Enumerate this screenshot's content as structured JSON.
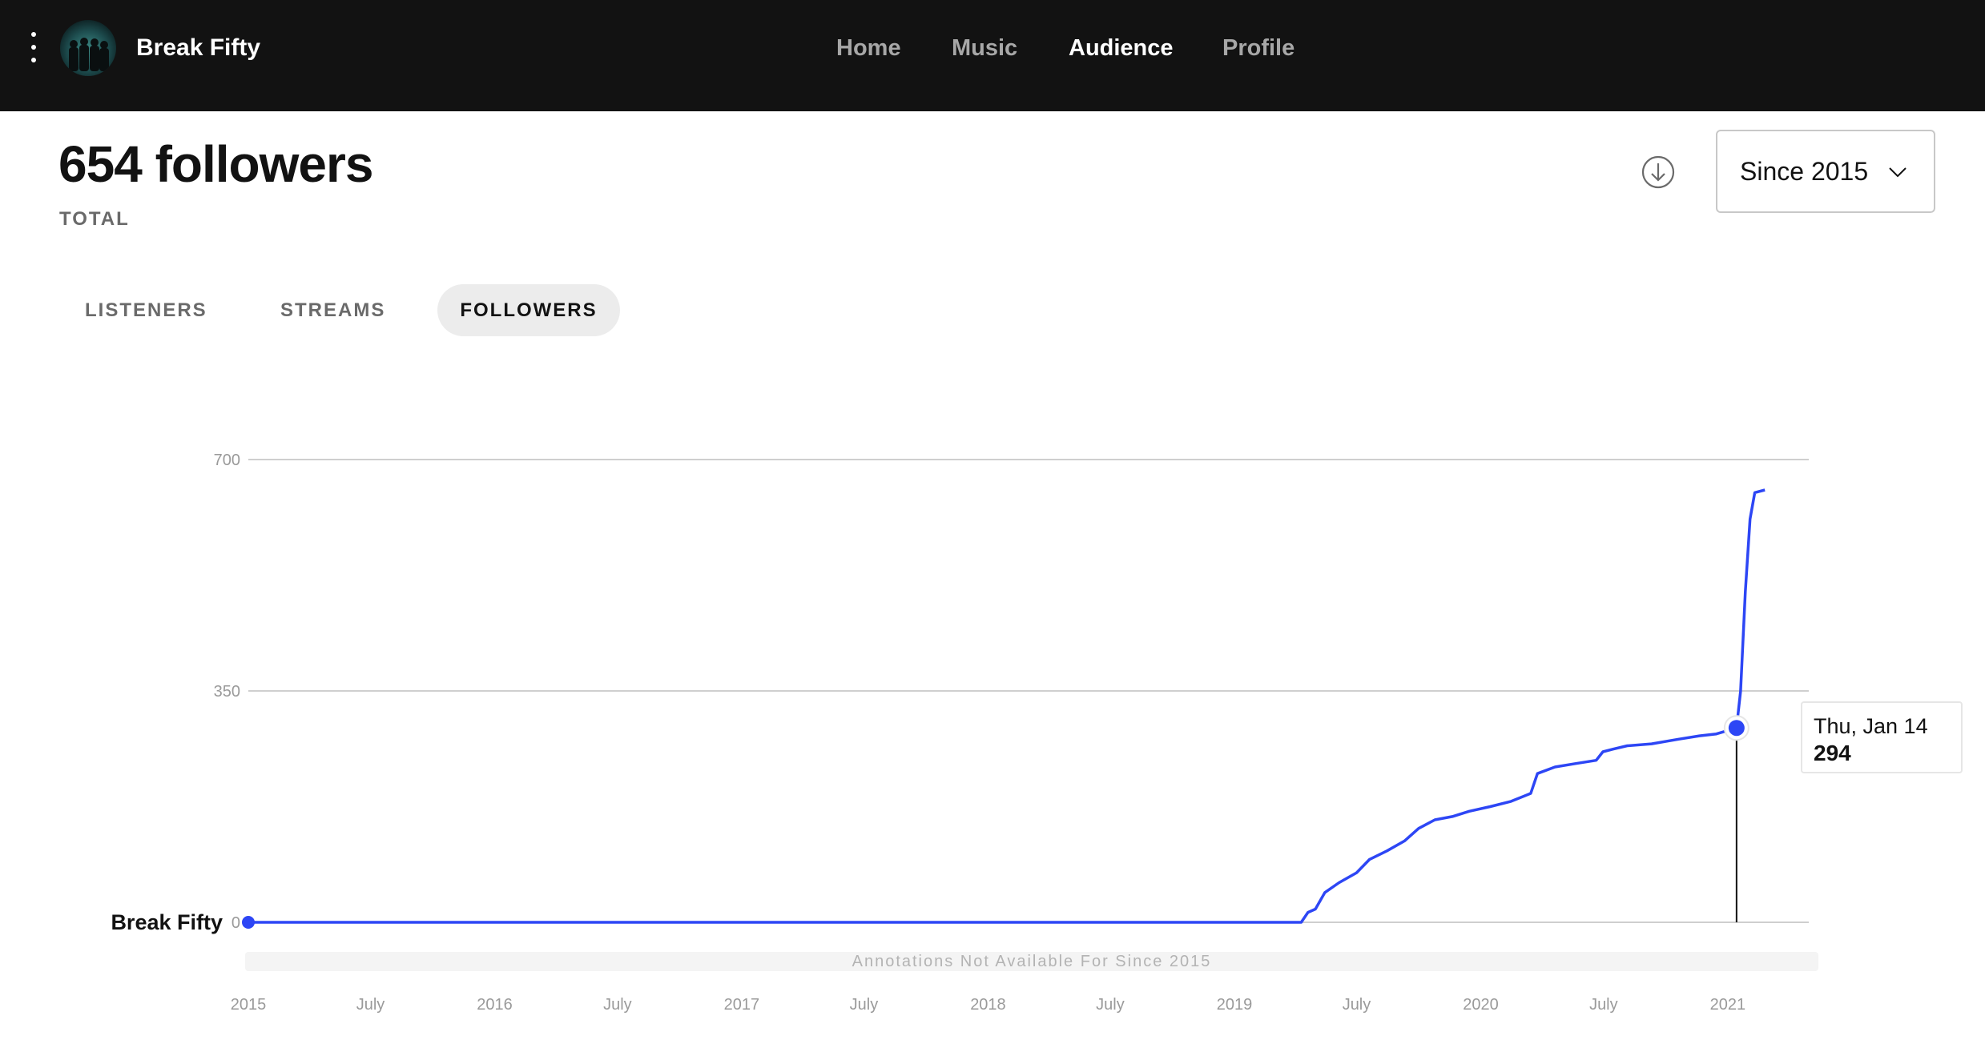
{
  "header": {
    "artist_name": "Break Fifty",
    "nav": [
      {
        "label": "Home",
        "active": false
      },
      {
        "label": "Music",
        "active": false
      },
      {
        "label": "Audience",
        "active": true
      },
      {
        "label": "Profile",
        "active": false
      }
    ]
  },
  "summary": {
    "total": "654 followers",
    "total_label": "TOTAL"
  },
  "range_select": {
    "value": "Since 2015"
  },
  "tabs": [
    {
      "label": "LISTENERS",
      "active": false
    },
    {
      "label": "STREAMS",
      "active": false
    },
    {
      "label": "FOLLOWERS",
      "active": true
    }
  ],
  "tooltip": {
    "date": "Thu, Jan 14",
    "value": "294"
  },
  "annotation_text": "Annotations Not Available For Since 2015",
  "colors": {
    "accent": "#2d46f5",
    "topbar": "#121212"
  },
  "chart_data": {
    "type": "line",
    "title": "",
    "xlabel": "",
    "ylabel": "",
    "series_label": "Break Fifty",
    "ylim": [
      0,
      700
    ],
    "yticks": [
      0,
      350,
      700
    ],
    "xlim": [
      "2015-01-01",
      "2021-05-01"
    ],
    "xticks": [
      {
        "date": "2015-01-01",
        "label": "2015"
      },
      {
        "date": "2015-07-01",
        "label": "July"
      },
      {
        "date": "2016-01-01",
        "label": "2016"
      },
      {
        "date": "2016-07-01",
        "label": "July"
      },
      {
        "date": "2017-01-01",
        "label": "2017"
      },
      {
        "date": "2017-07-01",
        "label": "July"
      },
      {
        "date": "2018-01-01",
        "label": "2018"
      },
      {
        "date": "2018-07-01",
        "label": "July"
      },
      {
        "date": "2019-01-01",
        "label": "2019"
      },
      {
        "date": "2019-07-01",
        "label": "July"
      },
      {
        "date": "2020-01-01",
        "label": "2020"
      },
      {
        "date": "2020-07-01",
        "label": "July"
      },
      {
        "date": "2021-01-01",
        "label": "2021"
      }
    ],
    "grid": true,
    "series": [
      {
        "points": [
          [
            "2015-01-01",
            0
          ],
          [
            "2019-04-10",
            0
          ],
          [
            "2019-04-20",
            15
          ],
          [
            "2019-05-01",
            20
          ],
          [
            "2019-05-15",
            45
          ],
          [
            "2019-06-05",
            60
          ],
          [
            "2019-07-01",
            75
          ],
          [
            "2019-07-20",
            95
          ],
          [
            "2019-08-15",
            108
          ],
          [
            "2019-09-10",
            123
          ],
          [
            "2019-10-01",
            142
          ],
          [
            "2019-10-25",
            155
          ],
          [
            "2019-11-20",
            160
          ],
          [
            "2019-12-15",
            168
          ],
          [
            "2020-01-15",
            175
          ],
          [
            "2020-02-15",
            183
          ],
          [
            "2020-03-15",
            195
          ],
          [
            "2020-03-25",
            225
          ],
          [
            "2020-04-20",
            235
          ],
          [
            "2020-05-20",
            240
          ],
          [
            "2020-06-20",
            245
          ],
          [
            "2020-06-30",
            258
          ],
          [
            "2020-07-15",
            262
          ],
          [
            "2020-08-05",
            267
          ],
          [
            "2020-09-10",
            270
          ],
          [
            "2020-10-20",
            277
          ],
          [
            "2020-11-20",
            282
          ],
          [
            "2020-12-15",
            285
          ],
          [
            "2021-01-14",
            294
          ],
          [
            "2021-01-20",
            350
          ],
          [
            "2021-01-27",
            500
          ],
          [
            "2021-02-03",
            610
          ],
          [
            "2021-02-10",
            650
          ],
          [
            "2021-02-25",
            654
          ]
        ]
      }
    ],
    "highlight": {
      "date": "2021-01-14",
      "value": 294
    },
    "start_marker": {
      "date": "2015-01-01",
      "value": 0
    }
  }
}
